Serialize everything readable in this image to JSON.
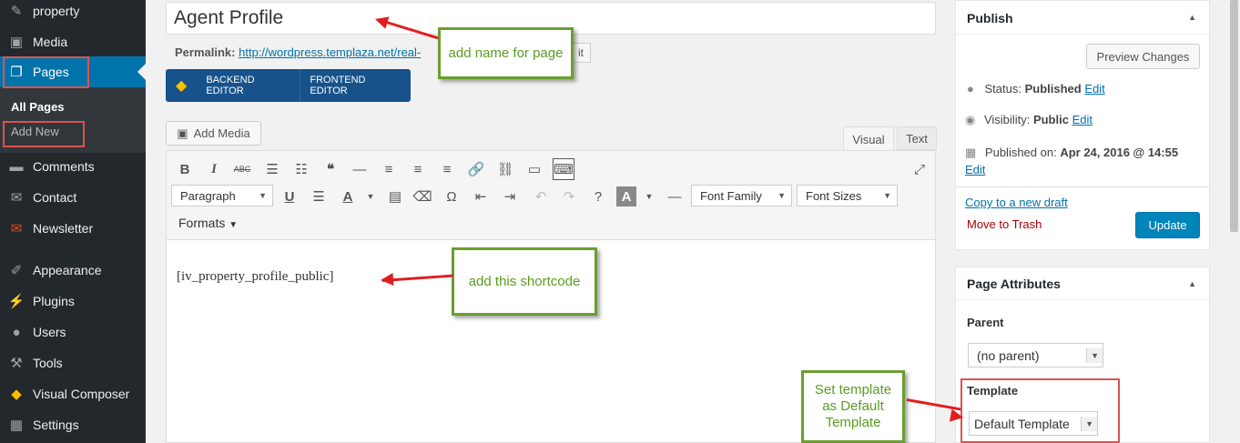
{
  "sidebar": {
    "items": [
      {
        "label": "property",
        "icon": "pin-icon"
      },
      {
        "label": "Media",
        "icon": "media-icon"
      },
      {
        "label": "Pages",
        "icon": "pages-icon"
      },
      {
        "label": "Comments",
        "icon": "comments-icon"
      },
      {
        "label": "Contact",
        "icon": "envelope-icon"
      },
      {
        "label": "Newsletter",
        "icon": "newsletter-icon"
      },
      {
        "label": "Appearance",
        "icon": "paintbrush-icon"
      },
      {
        "label": "Plugins",
        "icon": "plugin-icon"
      },
      {
        "label": "Users",
        "icon": "users-icon"
      },
      {
        "label": "Tools",
        "icon": "wrench-icon"
      },
      {
        "label": "Visual Composer",
        "icon": "vc-logo-icon"
      },
      {
        "label": "Settings",
        "icon": "settings-icon"
      }
    ],
    "submenu": {
      "all_pages": "All Pages",
      "add_new": "Add New"
    }
  },
  "editor": {
    "title": "Agent Profile",
    "permalink_label": "Permalink:",
    "permalink_url": "http://wordpress.templaza.net/real-",
    "edit_slug": "it",
    "backend_editor": "BACKEND EDITOR",
    "frontend_editor": "FRONTEND EDITOR",
    "add_media": "Add Media",
    "tab_visual": "Visual",
    "tab_text": "Text",
    "format_select": "Paragraph",
    "font_family": "Font Family",
    "font_sizes": "Font Sizes",
    "formats": "Formats",
    "content": "[iv_property_profile_public]"
  },
  "publish": {
    "title": "Publish",
    "preview": "Preview Changes",
    "status_label": "Status:",
    "status_value": "Published",
    "visibility_label": "Visibility:",
    "visibility_value": "Public",
    "published_on_label": "Published on:",
    "published_on_value": "Apr 24, 2016 @ 14:55",
    "edit": "Edit",
    "copy_draft": "Copy to a new draft",
    "trash": "Move to Trash",
    "update": "Update"
  },
  "page_attributes": {
    "title": "Page Attributes",
    "parent_label": "Parent",
    "parent_value": "(no parent)",
    "template_label": "Template",
    "template_value": "Default Template"
  },
  "annotations": {
    "name_note": "add name for page",
    "shortcode_note": "add this shortcode",
    "template_note": "Set template as Default Template"
  },
  "colors": {
    "sidebar": "#23282d",
    "active": "#0073aa",
    "annotation_green": "#6a9e2f",
    "arrow_red": "#e21d1d"
  }
}
